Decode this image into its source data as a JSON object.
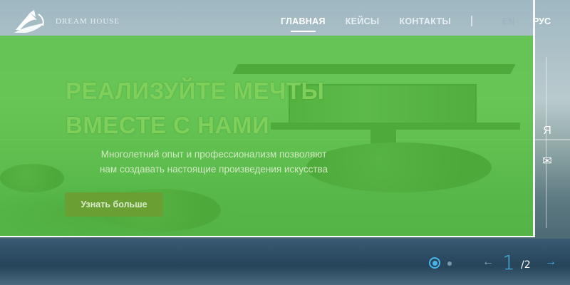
{
  "brand": {
    "name": "DREAM HOUSE"
  },
  "nav": [
    {
      "label": "ГЛАВНАЯ",
      "active": true
    },
    {
      "label": "КЕЙСЫ",
      "active": false
    },
    {
      "label": "КОНТАКТЫ",
      "active": false
    }
  ],
  "languages": {
    "en": "EN",
    "ru": "РУС",
    "selected": "РУС"
  },
  "hero": {
    "title_line1": "РЕАЛИЗУЙТЕ МЕЧТЫ",
    "title_line2": "ВМЕСТЕ С НАМИ",
    "subtitle_line1": "Многолетний опыт и профессионализм позволяют",
    "subtitle_line2": "нам создавать настоящие произведения искусства",
    "cta_label": "Узнать больше"
  },
  "side_icons": {
    "ya_glyph": "Я",
    "mail_glyph": "✉"
  },
  "slider": {
    "current": "1",
    "total": "/2",
    "prev_glyph": "←",
    "next_glyph": "→"
  },
  "colors": {
    "overlay": "#56c43c",
    "accent": "#46b6e8",
    "cta": "#6a9f33"
  }
}
